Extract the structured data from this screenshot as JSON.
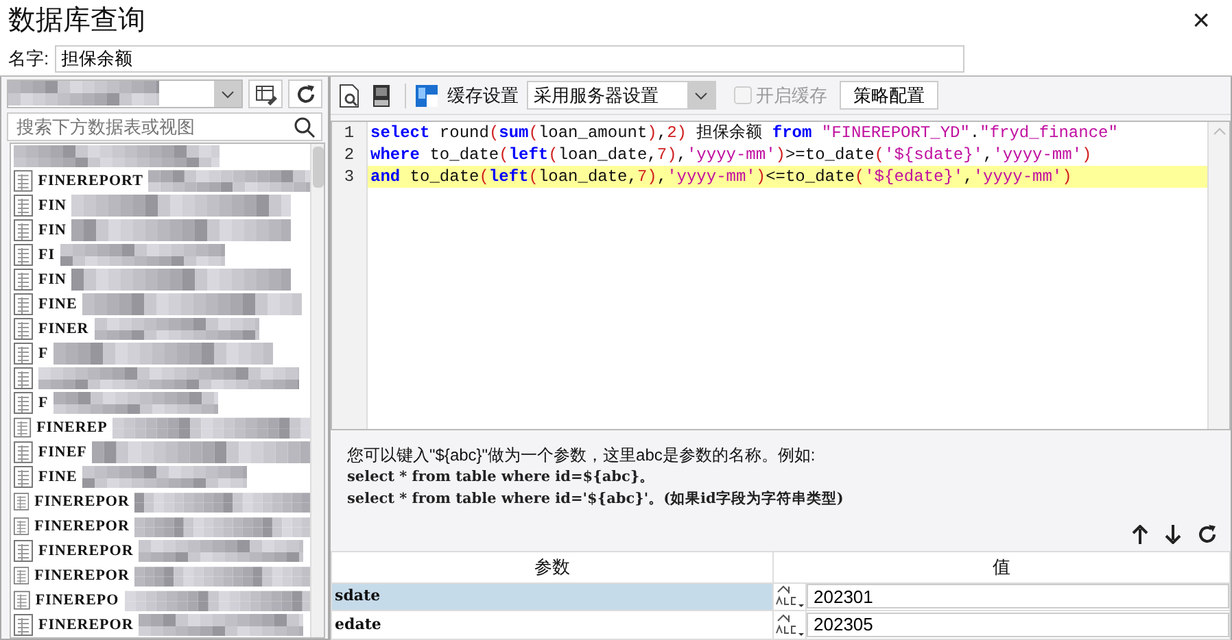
{
  "window": {
    "title": "数据库查询",
    "close": "×"
  },
  "name_field": {
    "label": "名字:",
    "value": "担保余额"
  },
  "left_panel": {
    "search_placeholder": "搜索下方数据表或视图",
    "tables": [
      {
        "label": "FINEREPORT"
      },
      {
        "label": "FIN"
      },
      {
        "label": "FIN"
      },
      {
        "label": "FI"
      },
      {
        "label": "FIN"
      },
      {
        "label": "FINE"
      },
      {
        "label": "FINER"
      },
      {
        "label": "F"
      },
      {
        "kind": "hidden"
      },
      {
        "label": "F"
      },
      {
        "label": "FINEREP"
      },
      {
        "label": "FINEF"
      },
      {
        "label": "FINE"
      },
      {
        "label": "FINEREPOR"
      },
      {
        "label": "FINEREPOR"
      },
      {
        "label": "FINEREPOR"
      },
      {
        "label": "FINEREPOR"
      },
      {
        "label": "FINEREPO"
      },
      {
        "label": "FINEREPOR"
      }
    ]
  },
  "toolbar": {
    "cache_label": "缓存设置",
    "cache_select": "采用服务器设置",
    "enable_cache": {
      "label": "开启缓存",
      "checked": false,
      "disabled": true
    },
    "strategy_button": "策略配置"
  },
  "editor": {
    "lines": [
      {
        "number": "1",
        "highlighted": false,
        "tokens": [
          {
            "kind": "keyword",
            "text": "select"
          },
          {
            "kind": "plain",
            "text": " round"
          },
          {
            "kind": "paren",
            "text": "("
          },
          {
            "kind": "keyword",
            "text": "sum"
          },
          {
            "kind": "paren",
            "text": "("
          },
          {
            "kind": "plain",
            "text": "loan_amount"
          },
          {
            "kind": "paren",
            "text": ")"
          },
          {
            "kind": "plain",
            "text": ","
          },
          {
            "kind": "number",
            "text": "2"
          },
          {
            "kind": "paren",
            "text": ")"
          },
          {
            "kind": "plain",
            "text": " 担保余额 "
          },
          {
            "kind": "keyword",
            "text": "from"
          },
          {
            "kind": "string",
            "text": " \"FINEREPORT_YD\""
          },
          {
            "kind": "plain",
            "text": "."
          },
          {
            "kind": "string",
            "text": "\"fryd_finance\""
          }
        ]
      },
      {
        "number": "2",
        "highlighted": false,
        "tokens": [
          {
            "kind": "keyword",
            "text": "where"
          },
          {
            "kind": "plain",
            "text": " to_date"
          },
          {
            "kind": "paren",
            "text": "("
          },
          {
            "kind": "keyword",
            "text": "left"
          },
          {
            "kind": "paren",
            "text": "("
          },
          {
            "kind": "plain",
            "text": "loan_date,"
          },
          {
            "kind": "number",
            "text": "7"
          },
          {
            "kind": "paren",
            "text": ")"
          },
          {
            "kind": "plain",
            "text": ","
          },
          {
            "kind": "string",
            "text": "'yyyy-mm'"
          },
          {
            "kind": "paren",
            "text": ")"
          },
          {
            "kind": "plain",
            "text": ">=to_date"
          },
          {
            "kind": "paren",
            "text": "("
          },
          {
            "kind": "string",
            "text": "'${sdate}'"
          },
          {
            "kind": "plain",
            "text": ","
          },
          {
            "kind": "string",
            "text": "'yyyy-mm'"
          },
          {
            "kind": "paren",
            "text": ")"
          }
        ]
      },
      {
        "number": "3",
        "highlighted": true,
        "tokens": [
          {
            "kind": "keyword",
            "text": "and"
          },
          {
            "kind": "plain",
            "text": " to_date"
          },
          {
            "kind": "paren",
            "text": "("
          },
          {
            "kind": "keyword",
            "text": "left"
          },
          {
            "kind": "paren",
            "text": "("
          },
          {
            "kind": "plain",
            "text": "loan_date,"
          },
          {
            "kind": "number",
            "text": "7"
          },
          {
            "kind": "paren",
            "text": ")"
          },
          {
            "kind": "plain",
            "text": ","
          },
          {
            "kind": "string",
            "text": "'yyyy-mm'"
          },
          {
            "kind": "paren",
            "text": ")"
          },
          {
            "kind": "plain",
            "text": "<=to_date"
          },
          {
            "kind": "paren",
            "text": "("
          },
          {
            "kind": "string",
            "text": "'${edate}'"
          },
          {
            "kind": "plain",
            "text": ","
          },
          {
            "kind": "string",
            "text": "'yyyy-mm'"
          },
          {
            "kind": "paren",
            "text": ")"
          }
        ]
      }
    ]
  },
  "hint": {
    "lines": [
      "您可以键入\"${abc}\"做为一个参数，这里abc是参数的名称。例如:",
      "select * from table where id=${abc}。",
      "select * from table where id='${abc}'。(如果id字段为字符串类型)"
    ]
  },
  "parameters": {
    "columns": [
      "参数",
      "值"
    ],
    "rows": [
      {
        "name": "sdate",
        "value": "202301",
        "selected": true
      },
      {
        "name": "edate",
        "value": "202305",
        "selected": false
      }
    ]
  }
}
